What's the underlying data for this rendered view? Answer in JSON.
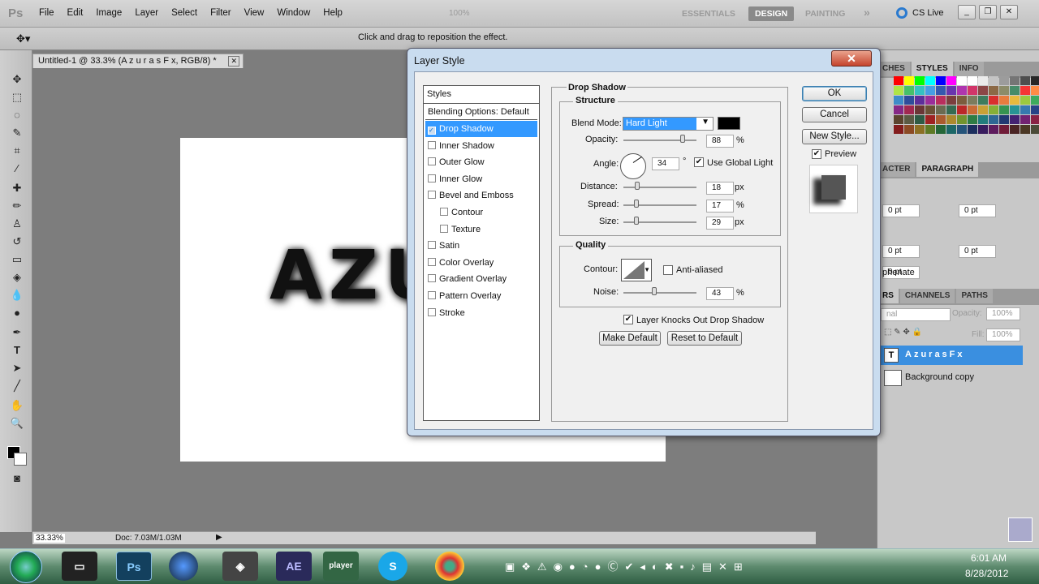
{
  "app": {
    "logo": "Ps"
  },
  "menu": [
    "File",
    "Edit",
    "Image",
    "Layer",
    "Select",
    "Filter",
    "View",
    "Window",
    "Help"
  ],
  "menubar": {
    "zoom": "100%",
    "workspaces": [
      "ESSENTIALS",
      "DESIGN",
      "PAINTING"
    ],
    "more": "»",
    "cs_live": "CS Live"
  },
  "options_bar": {
    "message": "Click and drag to reposition the effect."
  },
  "document": {
    "tab_title": "Untitled-1 @ 33.3% (A z u r a s F x, RGB/8) *",
    "canvas_text": "AZUR"
  },
  "statusbar": {
    "zoom": "33.33%",
    "doc_size": "Doc: 7.03M/1.03M"
  },
  "panels": {
    "top_tabs": [
      "CHES",
      "STYLES",
      "INFO"
    ],
    "char_tabs": [
      "ACTER",
      "PARAGRAPH"
    ],
    "para_fields": [
      "0 pt",
      "0 pt",
      "0 pt",
      "0 pt",
      "0 pt"
    ],
    "hyphenate": "phenate",
    "layer_tabs": [
      "RS",
      "CHANNELS",
      "PATHS"
    ],
    "blend_value": "nal",
    "opacity_label": "Opacity:",
    "opacity_value": "100%",
    "fill_label": "Fill:",
    "fill_value": "100%",
    "layers": [
      {
        "name": "AzurasFx",
        "thumb": "T"
      },
      {
        "name": "Background copy"
      }
    ]
  },
  "dialog": {
    "title": "Layer Style",
    "close": "✕",
    "styles_header": "Styles",
    "blending": "Blending Options: Default",
    "styles": [
      {
        "label": "Drop Shadow",
        "checked": true,
        "selected": true,
        "indent": false
      },
      {
        "label": "Inner Shadow",
        "checked": false,
        "indent": false
      },
      {
        "label": "Outer Glow",
        "checked": false,
        "indent": false
      },
      {
        "label": "Inner Glow",
        "checked": false,
        "indent": false
      },
      {
        "label": "Bevel and Emboss",
        "checked": false,
        "indent": false
      },
      {
        "label": "Contour",
        "checked": false,
        "indent": true
      },
      {
        "label": "Texture",
        "checked": false,
        "indent": true
      },
      {
        "label": "Satin",
        "checked": false,
        "indent": false
      },
      {
        "label": "Color Overlay",
        "checked": false,
        "indent": false
      },
      {
        "label": "Gradient Overlay",
        "checked": false,
        "indent": false
      },
      {
        "label": "Pattern Overlay",
        "checked": false,
        "indent": false
      },
      {
        "label": "Stroke",
        "checked": false,
        "indent": false
      }
    ],
    "section_title": "Drop Shadow",
    "structure": {
      "title": "Structure",
      "blend_mode_label": "Blend Mode:",
      "blend_mode_value": "Hard Light",
      "shadow_color": "#000000",
      "opacity_label": "Opacity:",
      "opacity_value": "88",
      "angle_label": "Angle:",
      "angle_value": "34",
      "degree": "°",
      "global_light": "Use Global Light",
      "distance_label": "Distance:",
      "distance_value": "18",
      "spread_label": "Spread:",
      "spread_value": "17",
      "size_label": "Size:",
      "size_value": "29",
      "unit_px": "px",
      "unit_pct": "%"
    },
    "quality": {
      "title": "Quality",
      "contour_label": "Contour:",
      "anti_aliased": "Anti-aliased",
      "noise_label": "Noise:",
      "noise_value": "43"
    },
    "knocks_out": "Layer Knocks Out Drop Shadow",
    "make_default": "Make Default",
    "reset_default": "Reset to Default",
    "ok": "OK",
    "cancel": "Cancel",
    "new_style": "New Style...",
    "preview": "Preview"
  },
  "taskbar": {
    "apps": [
      "Ps",
      "AE",
      "player"
    ],
    "time": "6:01 AM",
    "date": "8/28/2012"
  }
}
